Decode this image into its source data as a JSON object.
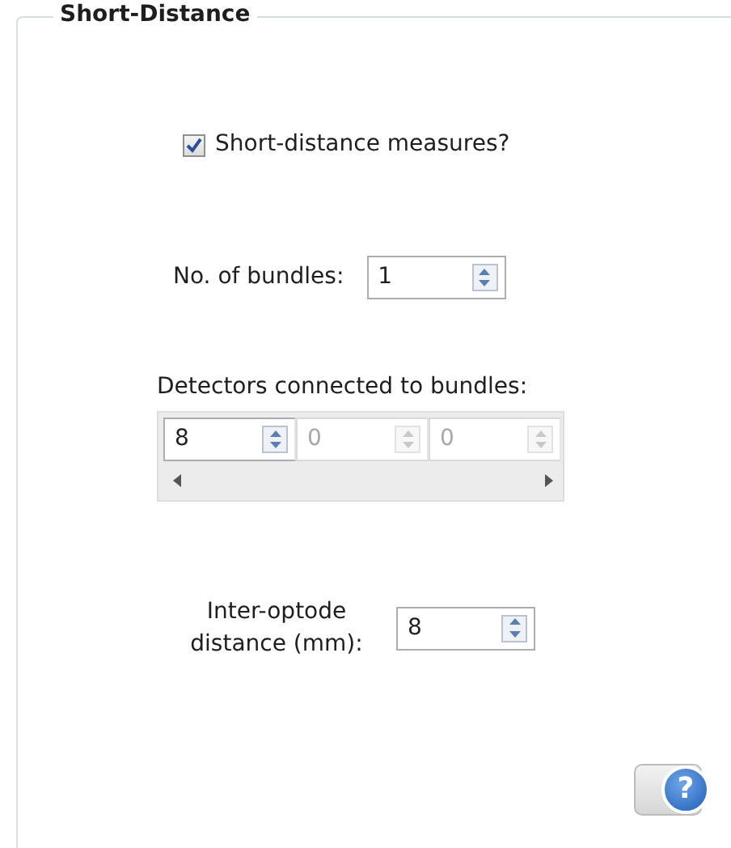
{
  "group": {
    "title": "Short-Distance"
  },
  "short_distance_checkbox": {
    "label": "Short-distance measures?",
    "checked": true
  },
  "bundles": {
    "label": "No. of bundles:",
    "value": "1"
  },
  "detectors": {
    "label": "Detectors connected to bundles:",
    "cells": [
      {
        "value": "8",
        "disabled": false
      },
      {
        "value": "0",
        "disabled": true
      },
      {
        "value": "0",
        "disabled": true
      }
    ]
  },
  "inter_optode": {
    "label": "Inter-optode distance (mm):",
    "value": "8"
  },
  "help_button": {
    "label": "?"
  }
}
